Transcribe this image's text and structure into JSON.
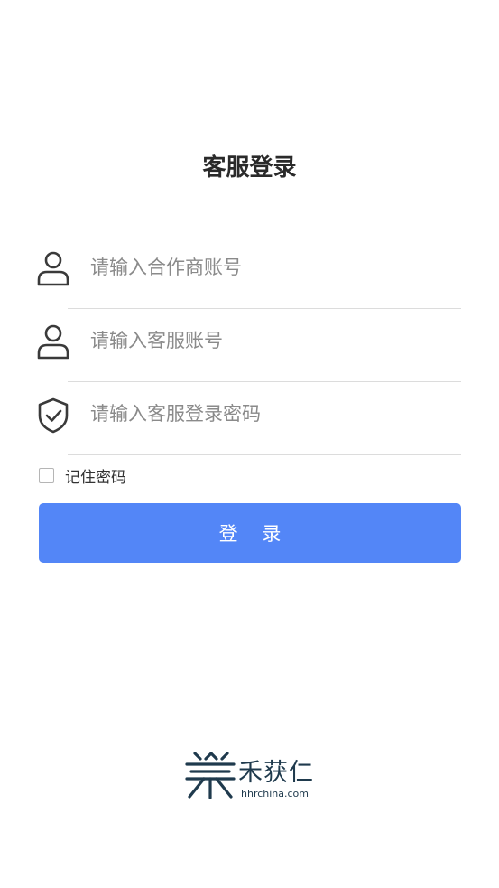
{
  "page": {
    "title": "客服登录"
  },
  "form": {
    "partner_account": {
      "placeholder": "请输入合作商账号",
      "value": "",
      "icon": "user-icon"
    },
    "service_account": {
      "placeholder": "请输入客服账号",
      "value": "",
      "icon": "user-icon"
    },
    "password": {
      "placeholder": "请输入客服登录密码",
      "value": "",
      "icon": "shield-check-icon"
    },
    "remember": {
      "label": "记住密码",
      "checked": false
    },
    "login_label": "登 录"
  },
  "brand": {
    "name": "禾获仁",
    "url": "hhrchina.com"
  },
  "colors": {
    "primary": "#5386f7",
    "text": "#2a2a2a",
    "placeholder": "#8a8a8a",
    "divider": "#dcdcdc",
    "brand": "#1f3a4d",
    "brand_accent": "#c0392b"
  }
}
